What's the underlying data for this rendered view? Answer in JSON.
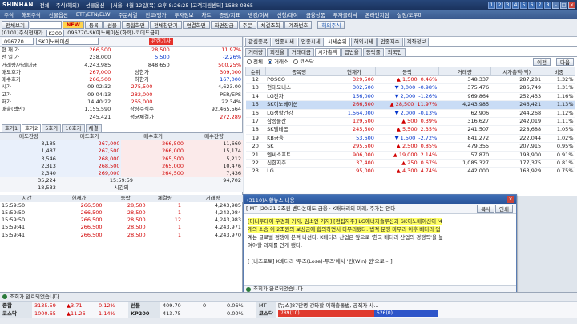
{
  "titlebar": {
    "brand": "SHINHAN",
    "items": [
      "전체",
      "주식(해외)",
      "선물옵션",
      "|서울| 4월 12일(목) 오후 8:26:25 [고객지원센터] 1588-0365"
    ],
    "nums": [
      "1",
      "2",
      "3",
      "4",
      "5",
      "6",
      "7",
      "8"
    ]
  },
  "menubar": {
    "items": [
      "주식",
      "해외주식",
      "선물옵션",
      "ETF/ETN/ELW",
      "주문체결",
      "잔고/평가",
      "투자정보",
      "차트",
      "증량/지표",
      "뱅킹/이체",
      "신청/대여",
      "금융상품",
      "투자클리닉",
      "온라인지점",
      "설정/도우미"
    ]
  },
  "toolbar": {
    "row1": [
      "전체보기",
      "NEW",
      "등록",
      "선물",
      "종합화면",
      "전체창닫기",
      "연결화면",
      "화면잠금",
      "주문",
      "체결조회",
      "계좌번호"
    ],
    "row1_extra": "해외주식",
    "row2": [
      "(0101)주식현재가",
      "K200",
      "096770-SK이노베이션(화학)-코데드금지"
    ]
  },
  "quote": {
    "code": "096770",
    "name": "SK이노베이션",
    "tag": "관련기사",
    "current_price": "266,500",
    "change": "28,500",
    "change_pct": "11.97%",
    "prev_close": "238,000",
    "prev_chg": "5,500",
    "prev_pct": "-2.26%",
    "volume": "4,243,985",
    "volume2": "848,650",
    "vol_pct": "500.25%",
    "rows": [
      {
        "l": "매도호가",
        "v": "267,000",
        "m": "상한가",
        "mv": "309,000"
      },
      {
        "l": "매수호가",
        "v": "266,500",
        "m": "하한가",
        "mv": "167,000"
      },
      {
        "l": "시가",
        "v": "09:02:32",
        "m": "275,500",
        "mv": "4,623.00"
      },
      {
        "l": "고가",
        "v": "09:04:13",
        "m": "282,000",
        "mv": "PER/EPS"
      },
      {
        "l": "저가",
        "v": "14:40:22",
        "m": "265,000",
        "mv": "22.34%"
      },
      {
        "l": "매출(백만)",
        "v": "1,155,590",
        "m": "상장주식수",
        "mv": "92,465,564"
      },
      {
        "l": "",
        "v": "245,421",
        "m": "평균체결가",
        "mv": "272,289"
      }
    ],
    "right_labels": [
      "자본금(억)",
      "PER/EPS",
      "외인소진",
      "액면가"
    ]
  },
  "orderbook": {
    "tabs": [
      "호가1",
      "호가2",
      "5호가",
      "10호가",
      "체결"
    ],
    "headers": [
      "매도잔량",
      "매도호가",
      "매수호가",
      "매수잔량"
    ],
    "ask": [
      {
        "q": "8,185",
        "p": "267,000"
      },
      {
        "q": "1,487",
        "p": "267,500"
      },
      {
        "q": "3,546",
        "p": "268,000"
      },
      {
        "q": "2,313",
        "p": "268,500"
      },
      {
        "q": "2,340",
        "p": "269,000"
      }
    ],
    "bid": [
      {
        "p": "266,500",
        "q": "11,669"
      },
      {
        "p": "266,000",
        "q": "15,174"
      },
      {
        "p": "265,500",
        "q": "5,212"
      },
      {
        "p": "265,000",
        "q": "10,476"
      },
      {
        "p": "264,500",
        "q": "7,436"
      }
    ],
    "totals": {
      "ask": "35,224",
      "time": "15:59:59",
      "bid": "94,702"
    },
    "after": {
      "ask": "18,533",
      "label": "시간외"
    }
  },
  "ticks": {
    "headers": [
      "시간",
      "현재가",
      "등락",
      "체결량",
      "거래량"
    ],
    "rows": [
      {
        "t": "15:59:50",
        "p": "266,500",
        "c": "28,500",
        "q": "1",
        "v": "4,243,985"
      },
      {
        "t": "15:59:50",
        "p": "266,500",
        "c": "28,500",
        "q": "1",
        "v": "4,243,984"
      },
      {
        "t": "15:59:50",
        "p": "266,500",
        "c": "28,500",
        "q": "12",
        "v": "4,243,983"
      },
      {
        "t": "15:59:41",
        "p": "266,500",
        "c": "28,500",
        "q": "1",
        "v": "4,243,971"
      },
      {
        "t": "15:59:41",
        "p": "266,500",
        "c": "28,500",
        "q": "1",
        "v": "4,243,970"
      }
    ]
  },
  "ranking": {
    "tabs1": [
      "관심종목",
      "업종시세",
      "업종시세",
      "시세순위",
      "해외시세",
      "업종지수",
      "계좌정보"
    ],
    "tabs2": [
      "거래량",
      "회전율",
      "거래대금",
      "시가총액",
      "급변율",
      "등락률",
      "외국인"
    ],
    "filters": [
      "전체",
      "거래소",
      "코스닥"
    ],
    "btn_prev": "이전",
    "btn_next": "다음",
    "headers": [
      "순위",
      "종목명",
      "현재가",
      "등락",
      "거래량",
      "시가총액(억)",
      "비중"
    ],
    "rows": [
      {
        "r": "12",
        "n": "POSCO",
        "p": "329,500",
        "c": "1,500",
        "pct": "0.46%",
        "v": "348,337",
        "cap": "287,281",
        "w": "1.32%",
        "s": "up"
      },
      {
        "r": "13",
        "n": "현대모비스",
        "p": "302,500",
        "c": "3,000",
        "pct": "-0.98%",
        "v": "375,476",
        "cap": "286,749",
        "w": "1.31%",
        "s": "dn"
      },
      {
        "r": "14",
        "n": "LG전자",
        "p": "156,000",
        "c": "2,000",
        "pct": "-1.26%",
        "v": "969,864",
        "cap": "252,433",
        "w": "1.16%",
        "s": "dn"
      },
      {
        "r": "15",
        "n": "SK이노베이션",
        "p": "266,500",
        "c": "28,500",
        "pct": "11.97%",
        "v": "4,243,985",
        "cap": "246,421",
        "w": "1.13%",
        "s": "up",
        "hl": true
      },
      {
        "r": "16",
        "n": "LG생활건강",
        "p": "1,564,000",
        "c": "2,000",
        "pct": "-0.13%",
        "v": "62,906",
        "cap": "244,268",
        "w": "1.12%",
        "s": "dn"
      },
      {
        "r": "17",
        "n": "삼성물산",
        "p": "129,500",
        "c": "500",
        "pct": "0.39%",
        "v": "316,627",
        "cap": "242,019",
        "w": "1.11%",
        "s": "up"
      },
      {
        "r": "18",
        "n": "SK텔레콤",
        "p": "245,500",
        "c": "5,500",
        "pct": "2.35%",
        "v": "241,507",
        "cap": "228,688",
        "w": "1.05%",
        "s": "up"
      },
      {
        "r": "19",
        "n": "KB금융",
        "p": "53,600",
        "c": "1,500",
        "pct": "-2.72%",
        "v": "841,272",
        "cap": "222,044",
        "w": "1.02%",
        "s": "dn"
      },
      {
        "r": "20",
        "n": "SK",
        "p": "295,500",
        "c": "2,500",
        "pct": "0.85%",
        "v": "479,355",
        "cap": "207,915",
        "w": "0.95%",
        "s": "up"
      },
      {
        "r": "21",
        "n": "엔씨소프트",
        "p": "906,000",
        "c": "19,000",
        "pct": "2.14%",
        "v": "57,870",
        "cap": "198,900",
        "w": "0.91%",
        "s": "up"
      },
      {
        "r": "22",
        "n": "신한지주",
        "p": "37,400",
        "c": "250",
        "pct": "0.67%",
        "v": "1,085,327",
        "cap": "177,375",
        "w": "0.81%",
        "s": "up"
      },
      {
        "r": "23",
        "n": "LG",
        "p": "95,000",
        "c": "4,300",
        "pct": "4.74%",
        "v": "442,000",
        "cap": "163,929",
        "w": "0.75%",
        "s": "up"
      }
    ]
  },
  "news": {
    "title": "(3110)시황뉴스 내용",
    "headline": "[ MT ]20:21 2조원 벤다논데도 금융 · K배터리의 미래, 주가는 안다",
    "btn_print": "복사",
    "btn_close": "인쇄",
    "body": [
      "[머니투데이 우경희 기자, 김소연 기자] [편집자주] LG에너지솔루션과 SK이노베이션이 '4",
      "개의 소송 이 2조원의 보상금에 합의하면서 마무리됐다. 법적 분쟁 마무리 이후 배터리 업",
      "계는 글로벌 경쟁에 본격 나선다. K배터리 산업은 앞으로 '한국 배터리 산업의 경쟁력'을 높",
      "여야할 과제를 안게 됐다.",
      "",
      "[ [비즈포토] K배터리 '투즈(Lose)-투즈'에서 '윈(Win) 윈'으로~ ]"
    ],
    "footer": "조회가 완료되었습니다."
  },
  "status": {
    "msg": "조회가 완료되었습니다.",
    "line1": [
      {
        "k": "종합",
        "v": "3135.59",
        "c": "▲3.71",
        "p": "0.12%"
      },
      {
        "k": "선물",
        "v": "409.70",
        "c": "0",
        "p": "0.06%"
      },
      {
        "k": "MT",
        "v": "[뉴스]87만명 강타할 이해충돌법, 공직자 사..."
      }
    ],
    "line2": [
      {
        "k": "코스닥",
        "v": "1000.65",
        "c": "▲11.26",
        "p": "1.14%"
      },
      {
        "k": "KP200",
        "v": "413.75",
        "c": "",
        "p": "0.00%"
      },
      {
        "k": "코스닥",
        "v": "789(10)",
        "v2": "526(0)"
      }
    ],
    "bar_up": 0.6
  }
}
